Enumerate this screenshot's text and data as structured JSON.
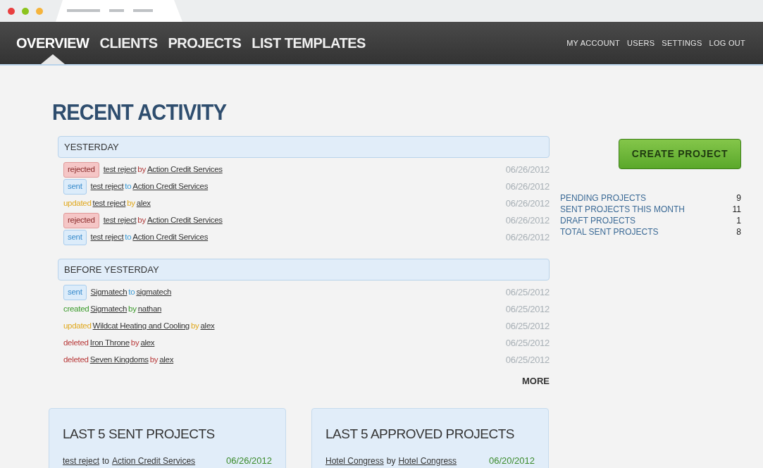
{
  "nav": {
    "items": [
      {
        "label": "OVERVIEW",
        "selected": true
      },
      {
        "label": "CLIENTS",
        "selected": false
      },
      {
        "label": "PROJECTS",
        "selected": false
      },
      {
        "label": "LIST TEMPLATES",
        "selected": false
      }
    ],
    "account_links": [
      "MY ACCOUNT",
      "USERS",
      "SETTINGS",
      "LOG OUT"
    ]
  },
  "heading": "RECENT ACTIVITY",
  "groups": [
    {
      "title": "YESTERDAY",
      "items": [
        {
          "kind": "rejected",
          "action": "rejected",
          "subject": "test reject",
          "connector": "by",
          "object": "Action Credit Services",
          "date": "06/26/2012"
        },
        {
          "kind": "sent",
          "action": "sent",
          "subject": "test reject",
          "connector": "to",
          "object": "Action Credit Services",
          "date": "06/26/2012"
        },
        {
          "kind": "updated",
          "action": "updated",
          "subject": "test reject",
          "connector": "by",
          "object": "alex",
          "date": "06/26/2012"
        },
        {
          "kind": "rejected",
          "action": "rejected",
          "subject": "test reject",
          "connector": "by",
          "object": "Action Credit Services",
          "date": "06/26/2012"
        },
        {
          "kind": "sent",
          "action": "sent",
          "subject": "test reject",
          "connector": "to",
          "object": "Action Credit Services",
          "date": "06/26/2012"
        }
      ]
    },
    {
      "title": "BEFORE YESTERDAY",
      "items": [
        {
          "kind": "sent",
          "action": "sent",
          "subject": "Sigmatech",
          "connector": "to",
          "object": "sigmatech",
          "date": "06/25/2012"
        },
        {
          "kind": "created",
          "action": "created",
          "subject": "Sigmatech",
          "connector": "by",
          "object": "nathan",
          "date": "06/25/2012"
        },
        {
          "kind": "updated",
          "action": "updated",
          "subject": "Wildcat Heating and Cooling",
          "connector": "by",
          "object": "alex",
          "date": "06/25/2012"
        },
        {
          "kind": "deleted",
          "action": "deleted",
          "subject": "Iron Throne",
          "connector": "by",
          "object": "alex",
          "date": "06/25/2012"
        },
        {
          "kind": "deleted",
          "action": "deleted",
          "subject": "Seven Kingdoms",
          "connector": "by",
          "object": "alex",
          "date": "06/25/2012"
        }
      ]
    }
  ],
  "more_link": "MORE",
  "create_button": "CREATE PROJECT",
  "stats": [
    {
      "label": "PENDING PROJECTS",
      "value": "9"
    },
    {
      "label": "SENT PROJECTS THIS MONTH",
      "value": "11"
    },
    {
      "label": "DRAFT PROJECTS",
      "value": "1"
    },
    {
      "label": "TOTAL SENT PROJECTS",
      "value": "8"
    }
  ],
  "cards": [
    {
      "title": "LAST 5 SENT PROJECTS",
      "rows": [
        {
          "subject": "test reject",
          "connector": "to",
          "object": "Action Credit Services",
          "date": "06/26/2012"
        }
      ]
    },
    {
      "title": "LAST 5 APPROVED PROJECTS",
      "rows": [
        {
          "subject": "Hotel Congress",
          "connector": "by",
          "object": "Hotel Congress",
          "date": "06/20/2012"
        }
      ]
    }
  ]
}
